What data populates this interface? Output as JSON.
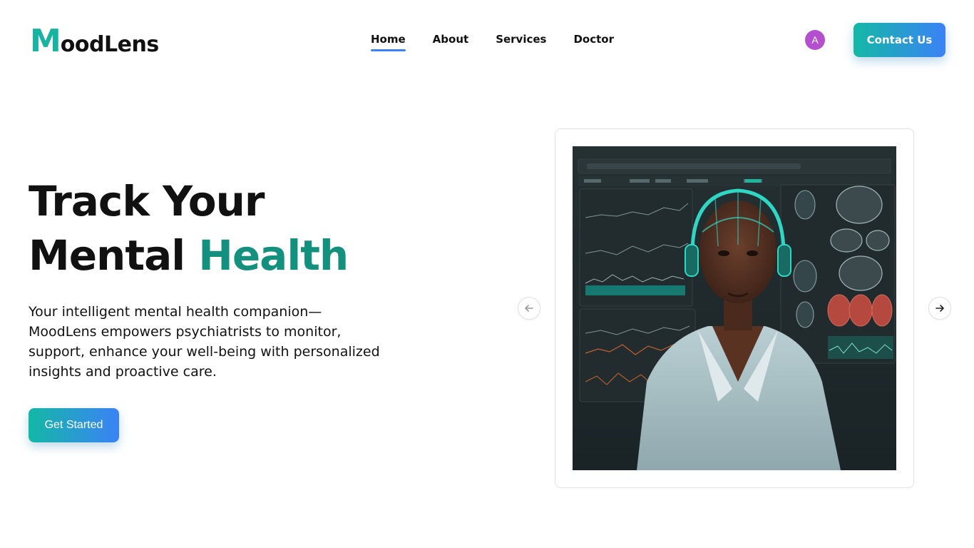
{
  "brand": {
    "logo_initial": "M",
    "logo_rest": "oodLens"
  },
  "nav": {
    "items": [
      {
        "label": "Home",
        "active": true
      },
      {
        "label": "About",
        "active": false
      },
      {
        "label": "Services",
        "active": false
      },
      {
        "label": "Doctor",
        "active": false
      }
    ]
  },
  "user": {
    "avatar_initial": "A",
    "avatar_color": "#b44fd0"
  },
  "header": {
    "contact_label": "Contact Us"
  },
  "hero": {
    "title_line1": "Track Your",
    "title_line2_plain": "Mental ",
    "title_line2_accent": "Health",
    "description": "Your intelligent mental health companion—MoodLens empowers psychiatrists to monitor, support, enhance your well-being with personalized insights and proactive care.",
    "cta_label": "Get Started"
  },
  "carousel": {
    "prev_icon": "arrow-left-icon",
    "next_icon": "arrow-right-icon"
  },
  "colors": {
    "accent_teal": "#14907f",
    "gradient_start": "#14b8a6",
    "gradient_end": "#3b82f6",
    "nav_underline": "#3b82f6"
  }
}
